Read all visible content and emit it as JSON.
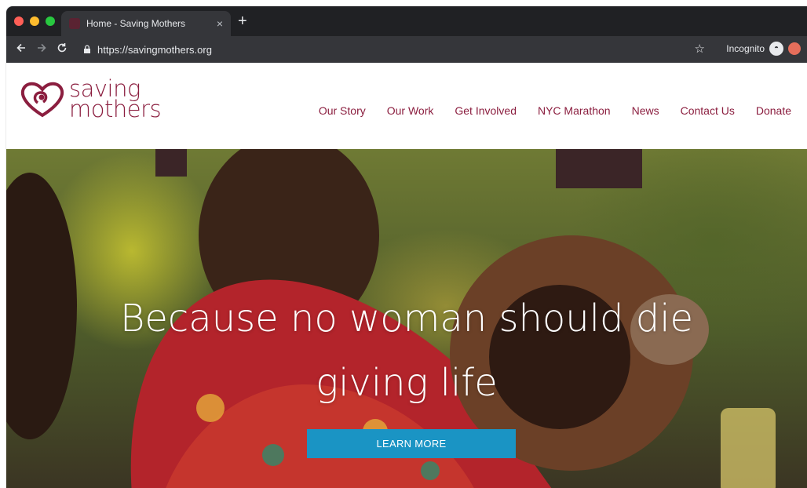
{
  "browser": {
    "tab_title": "Home - Saving Mothers",
    "tab_close": "×",
    "new_tab": "+",
    "url": "https://savingmothers.org",
    "incognito_label": "Incognito",
    "icons": {
      "back": "arrow-left-icon",
      "forward": "arrow-right-icon",
      "reload": "reload-icon",
      "lock": "lock-icon",
      "star": "star-icon",
      "incognito": "incognito-icon"
    }
  },
  "site": {
    "logo": {
      "line1": "saving",
      "line2": "mothers"
    },
    "nav": [
      {
        "label": "Our Story"
      },
      {
        "label": "Our Work"
      },
      {
        "label": "Get Involved"
      },
      {
        "label": "NYC Marathon"
      },
      {
        "label": "News"
      },
      {
        "label": "Contact Us"
      },
      {
        "label": "Donate"
      }
    ],
    "hero": {
      "title_line1": "Because no woman should die",
      "title_line2": "giving life",
      "cta_label": "LEARN MORE"
    }
  },
  "colors": {
    "brand": "#8b1e3f",
    "cta": "#1a94c4",
    "browser_dark": "#202124",
    "browser_toolbar": "#35363a"
  }
}
